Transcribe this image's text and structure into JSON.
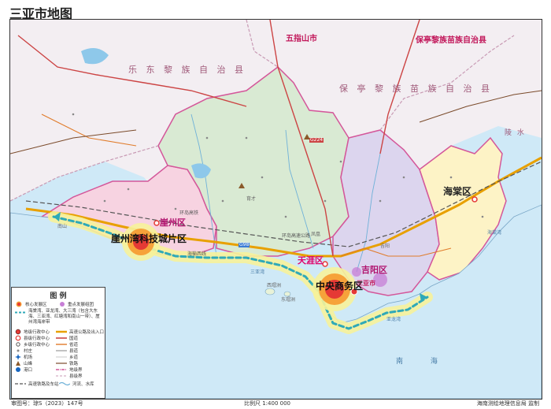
{
  "map": {
    "title": "三亚市地图",
    "counties": {
      "wuzhishan": "五指山市",
      "baoting": "保亭黎族苗族自治县",
      "baoting_band": "保 亭 黎 族 苗 族 自 治 县",
      "ledong": "乐 东 黎 族 自 治 县",
      "lingshui": "陵 水"
    },
    "districts": {
      "yazhou": "崖州区",
      "tianya": "天涯区",
      "jiyang": "吉阳区",
      "haitang": "海棠区"
    },
    "hubs": {
      "yazhou_bay": "崖州湾科技城片区",
      "cbd": "中央商务区"
    },
    "places": {
      "sanya_city": "三亚市",
      "nanshan": "南山",
      "sanya_bay": "三亚湾",
      "yalong_bay": "亚龙湾",
      "haitang_bay": "海棠湾",
      "ximao": "西瑁洲",
      "dongmao": "东瑁洲",
      "jiyang_small": "吉阳",
      "fenghuang": "凤凰",
      "yucai": "育才"
    },
    "roads": {
      "ring_expressway": "环岛高速公路",
      "ring_railway": "环岛高铁",
      "g98": "G98",
      "g224": "G224",
      "coast_road": "海榆西线"
    },
    "sea_label": "南 海",
    "colors": {
      "sea": "#cfe9f7",
      "coast_glow": "#f6f29a",
      "yazhou_fill": "#f7d3e1",
      "tianya_fill": "#d9ead3",
      "jiyang_fill": "#dcd5ee",
      "haitang_fill": "#fdf3c6",
      "outside_fill": "#f2f2f2",
      "boundary": "#d4579a",
      "hub_red": "#e53935",
      "dash_line": "#2fa9b8"
    }
  },
  "legend": {
    "title": "图 例",
    "items": [
      {
        "label": "核心发展区",
        "icon": "core-zone-icon"
      },
      {
        "label": "重点发展组团",
        "icon": "key-cluster-icon"
      },
      {
        "label": "海棠湾、亚龙湾、大三湾（包含大东海、三亚湾、红塘湾和南山一带）、崖州湾海岸带",
        "icon": "coast-band-icon"
      },
      {
        "label": "地级行政中心",
        "icon": "prefecture-center-icon"
      },
      {
        "label": "县级行政中心",
        "icon": "county-center-icon"
      },
      {
        "label": "乡级行政中心",
        "icon": "township-center-icon"
      },
      {
        "label": "村庄",
        "icon": "village-icon"
      },
      {
        "label": "机场",
        "icon": "airport-icon"
      },
      {
        "label": "山峰",
        "icon": "peak-icon"
      },
      {
        "label": "港口",
        "icon": "port-icon"
      },
      {
        "label": "高速公路及出入口",
        "icon": "expressway-icon"
      },
      {
        "label": "国道",
        "icon": "national-road-icon"
      },
      {
        "label": "省道",
        "icon": "provincial-road-icon"
      },
      {
        "label": "县道",
        "icon": "county-road-icon"
      },
      {
        "label": "乡道",
        "icon": "township-road-icon"
      },
      {
        "label": "铁路",
        "icon": "railway-icon"
      },
      {
        "label": "地级界",
        "icon": "prefecture-boundary-icon"
      },
      {
        "label": "县级界",
        "icon": "county-boundary-icon"
      },
      {
        "label": "高速铁路及车站",
        "icon": "highspeed-rail-icon"
      },
      {
        "label": "河流、水库",
        "icon": "river-icon"
      }
    ]
  },
  "footer": {
    "approval": "审图号：琼S（2023）147号",
    "scale": "比例尺  1:400 000",
    "publisher": "海南测绘地理信息局 监制"
  }
}
